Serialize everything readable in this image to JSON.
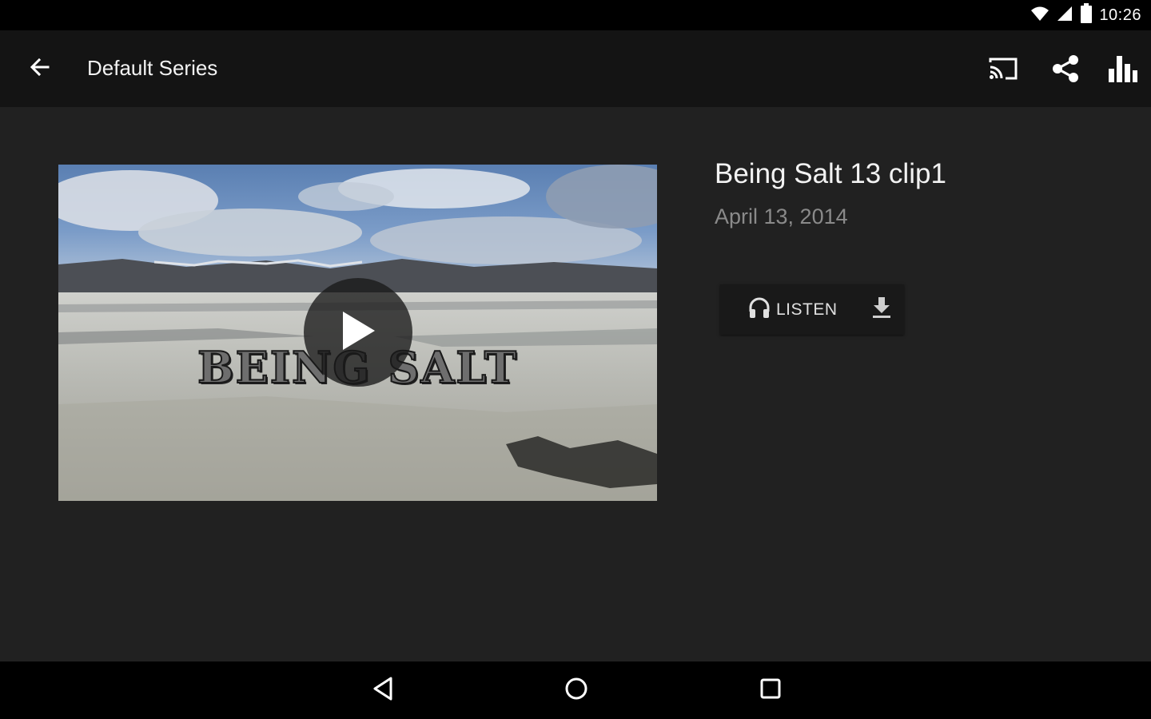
{
  "status_bar": {
    "time": "10:26",
    "icons": [
      "wifi-icon",
      "signal-icon",
      "battery-icon"
    ]
  },
  "app_bar": {
    "title": "Default Series",
    "back_icon": "arrow-back-icon",
    "actions": [
      "cast-icon",
      "share-icon",
      "stats-icon"
    ]
  },
  "episode": {
    "title": "Being Salt 13 clip1",
    "date": "April 13, 2014",
    "thumbnail_text": "BEING SALT",
    "listen_label": "LISTEN",
    "listen_icon": "headphones-icon",
    "download_icon": "download-icon",
    "play_icon": "play-icon"
  },
  "nav_bar": {
    "icons": [
      "nav-back-icon",
      "nav-home-icon",
      "nav-recents-icon"
    ]
  },
  "colors": {
    "background": "#212121",
    "app_bar": "#141414",
    "system_bars": "#000000",
    "primary_text": "#f2f2f2",
    "secondary_text": "#8a8a8a"
  }
}
